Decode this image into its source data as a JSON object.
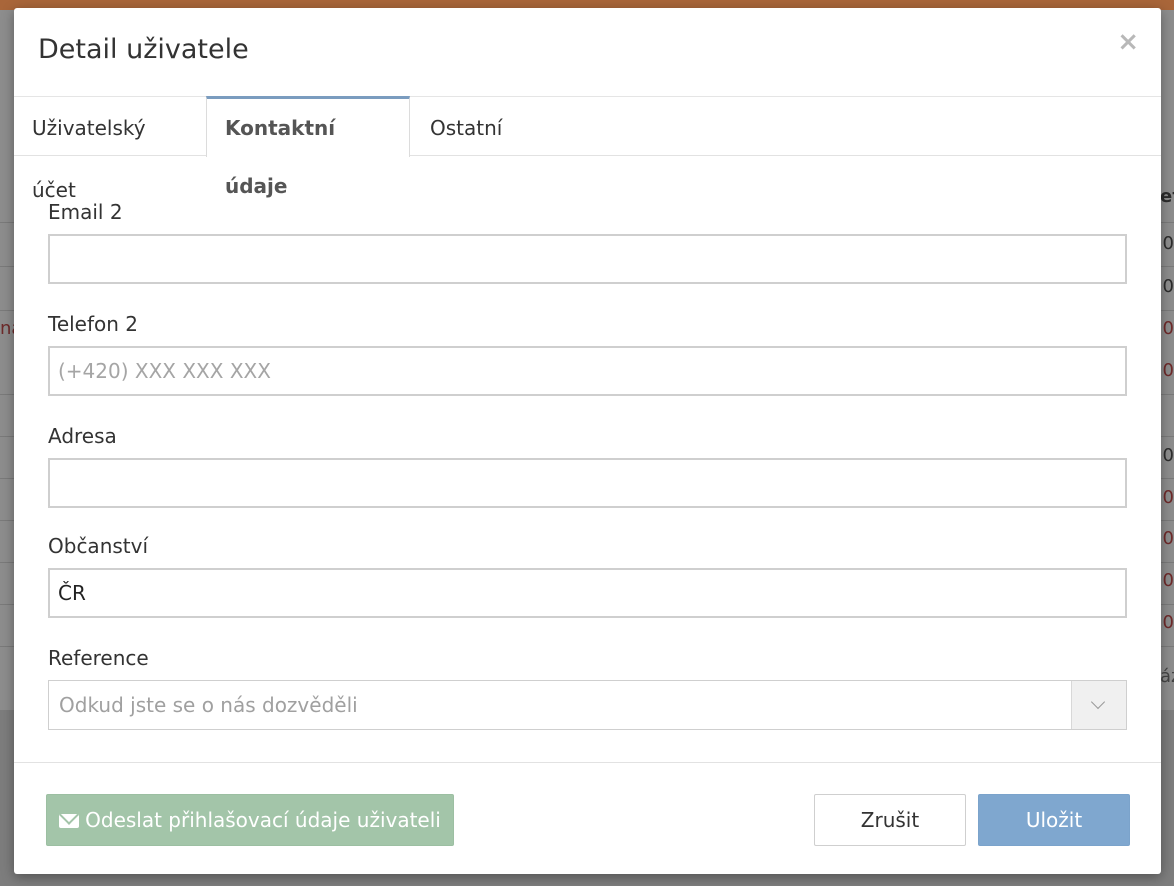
{
  "background": {
    "right_edge": [
      "ef",
      "0",
      "0",
      "0",
      "0",
      "0",
      "0",
      "0",
      "0",
      "0",
      "áz"
    ],
    "left_edge": "na"
  },
  "modal": {
    "title": "Detail uživatele",
    "close_icon": "×",
    "tabs": [
      {
        "label": "Uživatelský účet",
        "active": false
      },
      {
        "label": "Kontaktní údaje",
        "active": true
      },
      {
        "label": "Ostatní",
        "active": false
      }
    ],
    "fields": {
      "email2": {
        "label": "Email 2",
        "value": "",
        "placeholder": ""
      },
      "phone2": {
        "label": "Telefon 2",
        "value": "",
        "placeholder": "(+420) XXX XXX XXX"
      },
      "address": {
        "label": "Adresa",
        "value": "",
        "placeholder": ""
      },
      "citizenship": {
        "label": "Občanství",
        "value": "ČR",
        "placeholder": ""
      },
      "reference": {
        "label": "Reference",
        "placeholder": "Odkud jste se o nás dozvěděli"
      }
    },
    "footer": {
      "send_credentials_label": "Odeslat přihlašovací údaje uživateli",
      "cancel_label": "Zrušit",
      "save_label": "Uložit"
    },
    "colors": {
      "tab_active_accent": "#7a9cbf",
      "send_button": "#a3c5a9",
      "save_button": "#7fa7cf"
    }
  }
}
